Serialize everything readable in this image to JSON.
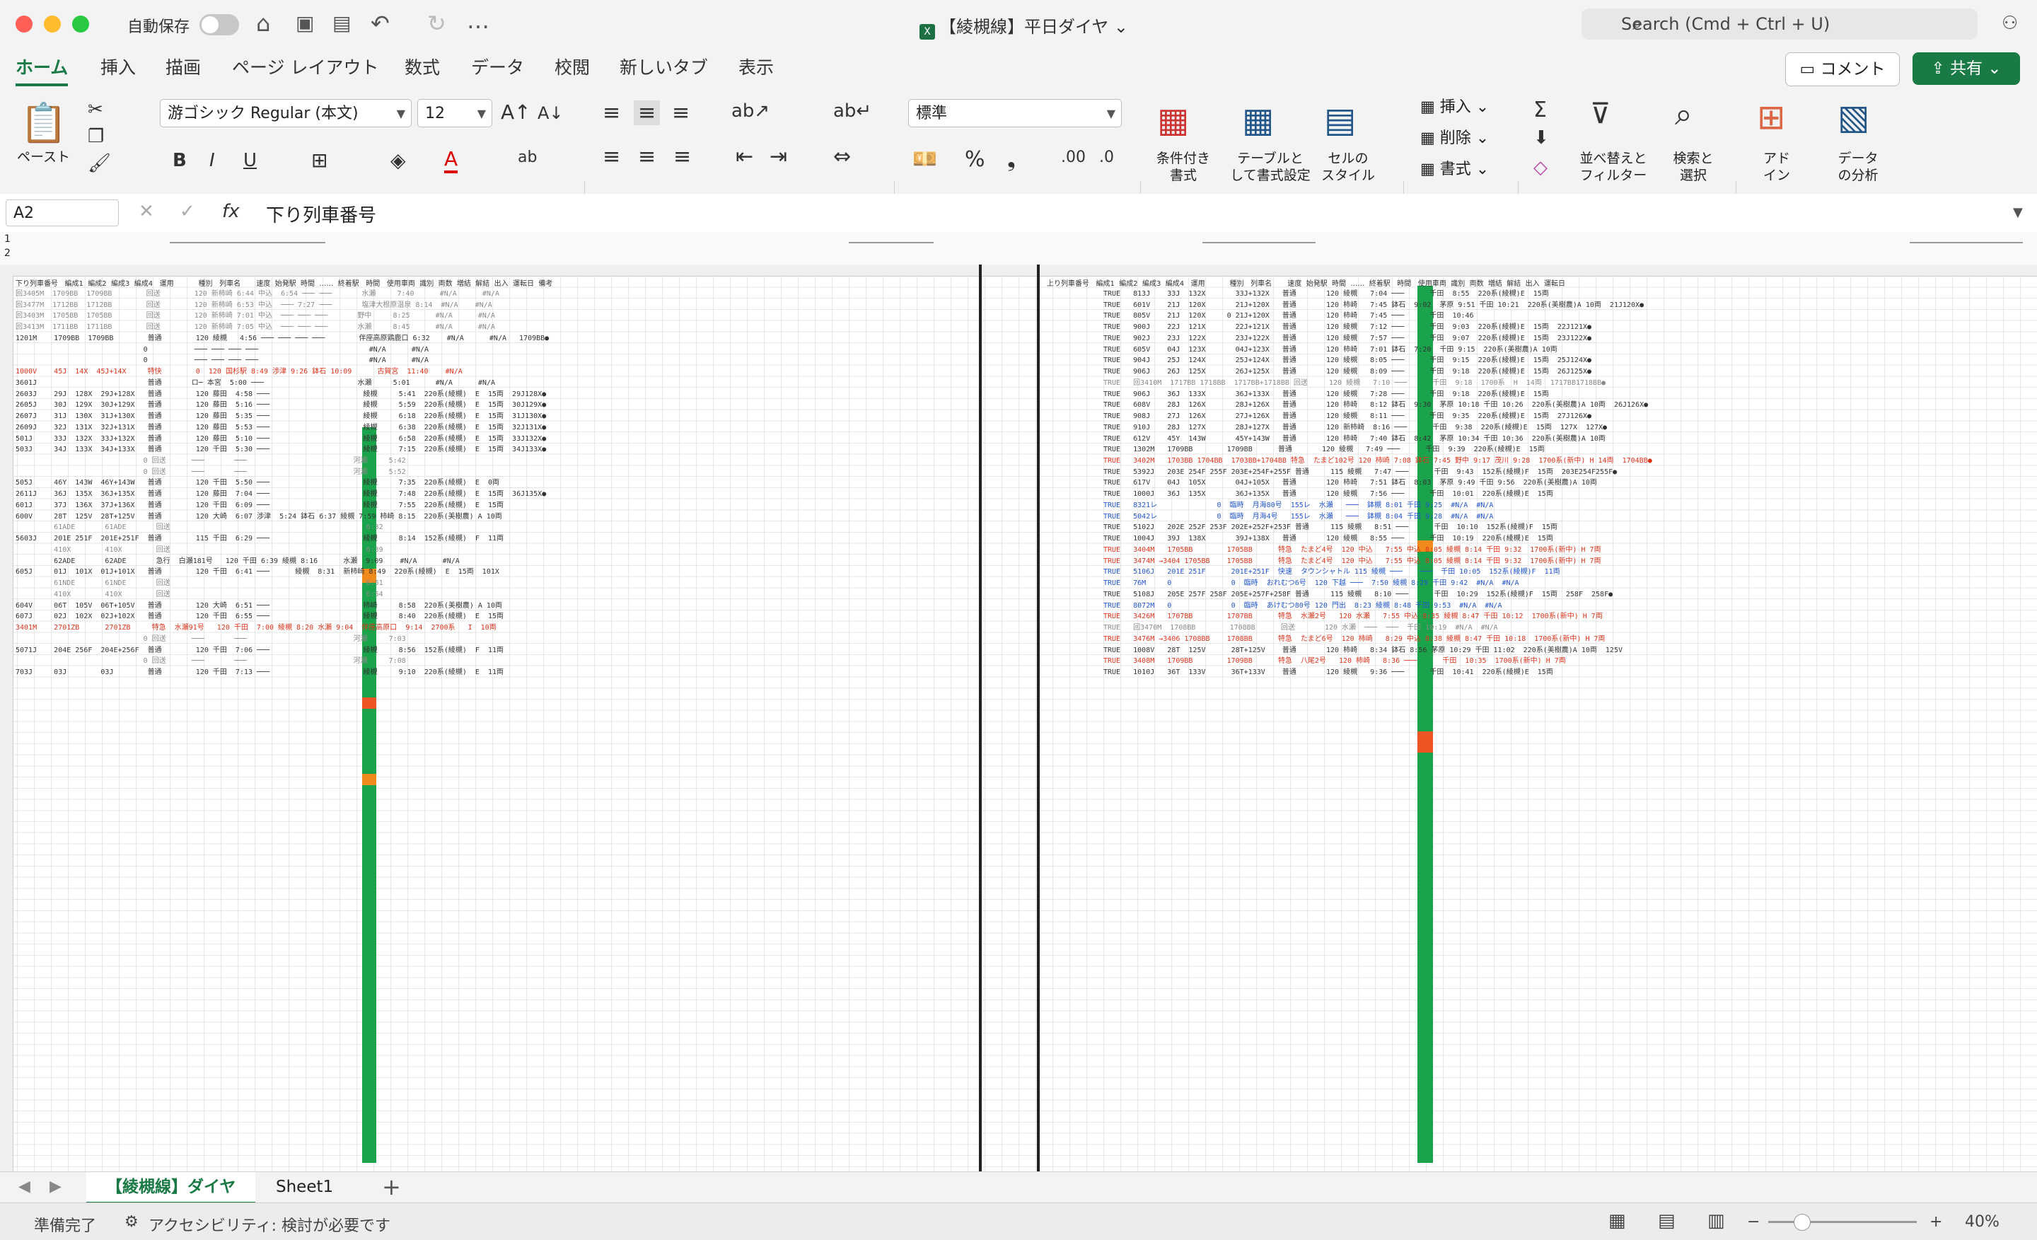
{
  "titlebar": {
    "autosave_label": "自動保存",
    "document_title": "【綾槻線】平日ダイヤ",
    "search_placeholder": "Search (Cmd + Ctrl + U)"
  },
  "tabs": [
    "ホーム",
    "挿入",
    "描画",
    "ページ レイアウト",
    "数式",
    "データ",
    "校閲",
    "新しいタブ",
    "表示"
  ],
  "buttons": {
    "comment": "コメント",
    "share": "共有"
  },
  "ribbon": {
    "paste": "ペースト",
    "font_name": "游ゴシック Regular (本文)",
    "font_size": "12",
    "number_format": "標準",
    "conditional": "条件付き\n書式",
    "table": "テーブルと\nして書式設定",
    "cell_style": "セルの\nスタイル",
    "insert": "挿入",
    "delete": "削除",
    "format": "書式",
    "sort_filter": "並べ替えと\nフィルター",
    "find_select": "検索と\n選択",
    "addin": "アド\nイン",
    "analyze": "データ\nの分析"
  },
  "formula_bar": {
    "name_box": "A2",
    "formula": "下り列車番号"
  },
  "sheet": {
    "left_header": "下り列車番号   編成1  編成2  編成3  編成4   運用           種別   列車名       速度  始発駅  時間  ……  終着駅   時間   使用車両  識別  両数  増結  解結  出入  運転日  備考",
    "right_header": "上り列車番号   編成1  編成2  編成3  編成4   運用           種別   列車名       速度  始発駅  時間  ……  終着駅   時間   使用車両  識別  両数  増結  解結  出入  運転日",
    "left_rows": [
      "回3405M  1709BB  1709BB        回送        120 新柿崎 6:44 中込  6:54 ─── ───       水瀬     7:40      #N/A      #N/A",
      "回3477M  1712BB  1712BB        回送        120 新柿崎 6:53 中込  ─── 7:27 ───       塩津大根原温泉 8:14  #N/A    #N/A",
      "回3403M  1705BB  1705BB        回送        120 新柿崎 7:01 中込  ─── ─── ───       野中     8:25      #N/A      #N/A",
      "回3413M  1711BB  1711BB        回送        120 新柿崎 7:05 中込  ─── ─── ───       水瀬     8:45      #N/A      #N/A",
      "1201M    1709BB  1709BB        普通        120 綾槻   4:56 ─── ─── ─── ───        伴座高原鶏鹿口 6:32    #N/A      #N/A   1709BB●",
      "                              0           ─── ─── ─── ───                          #N/A      #N/A",
      "                              0           ─── ─── ─── ───                          #N/A      #N/A",
      "1000V    45J  14X  45J+14X     特快        0  120 国杉駅 8:49 渉津 9:26 鉢石 10:09      古賀宮  11:40    #N/A",
      "3601J                          普通       ロ─ 本宮  5:00 ───                      水瀬     5:01      #N/A      #N/A",
      "2603J    29J  128X  29J+128X   普通        120 藤田  4:58 ───                      綾槻     5:41  220系(綾槻)  E  15両  29J128X●",
      "2605J    30J  129X  30J+129X   普通        120 藤田  5:16 ───                      綾槻     5:59  220系(綾槻)  E  15両  30J129X●",
      "2607J    31J  130X  31J+130X   普通        120 藤田  5:35 ───                      綾槻     6:18  220系(綾槻)  E  15両  31J130X●",
      "2609J    32J  131X  32J+131X   普通        120 藤田  5:53 ───                      綾槻     6:38  220系(綾槻)  E  15両  32J131X●",
      "501J     33J  132X  33J+132X   普通        120 藤田  5:10 ───                      綾槻     6:58  220系(綾槻)  E  15両  33J132X●",
      "503J     34J  133X  34J+133X   普通        120 千田  5:30 ───                      綾槻     7:15  220系(綾槻)  E  15両  34J133X●",
      "                              0 回送      ───       ───                         河瀬     5:42",
      "                              0 回送      ───       ───                         河瀬     5:52",
      "505J     46Y  143W  46Y+143W   普通        120 千田  5:50 ───                      綾槻     7:35  220系(綾槻)  E  0両",
      "2611J    36J  135X  36J+135X   普通        120 藤田  7:04 ───                      綾槻     7:48  220系(綾槻)  E  15両  36J135X●",
      "601J     37J  136X  37J+136X   普通        120 千田  6:09 ───                      綾槻     7:55  220系(綾槻)  E  15両",
      "600V     28T  125V  28T+125V   普通        120 大崎  6:07 渉津  5:24 鉢石 6:37 綾槻 7:59 柿崎 8:15  220系(美樹農) A 10両",
      "         61ADE       61ADE       回送                                              6:32",
      "5603J    201E 251F  201E+251F  普通        115 千田  6:29 ───                      綾槻     8:14  152系(綾槻)  F  11両",
      "         410X        410X        回送                                              6:39",
      "         62ADE       62ADE       急行  白瀬181号   120 千田 6:39 綾槻 8:16      水瀬  9:09    #N/A      #N/A",
      "605J     01J  101X  01J+101X   普通        120 千田  6:41 ───      綾槻  8:31  新柿崎 8:49  220系(綾槻)  E  15両  101X",
      "         61NDE       61NDE       回送                                              6:51",
      "         410X        410X        回送                                              6:54",
      "604V     06T  105V  06T+105V   普通        120 大崎  6:51 ───                      柿崎     8:58  220系(美樹農) A 10両",
      "607J     02J  102X  02J+102X   普通        120 千田  6:55 ───                      綾槻     8:40  220系(綾槻)  E  15両",
      "3401M    2701ZB      2701ZB     特急  水瀬91号   120 千田  7:00 綾槻 8:20 水瀬 9:04  伴座高原口  9:14  2700系   I  10両",
      "                              0 回送      ───       ───                         河瀬     7:03",
      "5071J    204E 256F  204E+256F  普通        120 千田  7:06 ───                      綾槻     8:56  152系(綾槻)  F  11両",
      "                              0 回送      ───       ───                         河瀬     7:08",
      "703J     03J        03J        普通        120 千田  7:13 ───                      綾槻     9:10  220系(綾槻)  E  11両"
    ],
    "right_rows": [
      "TRUE   813J    33J  132X       33J+132X   普通       120 綾槻   7:04 ───      千田  8:55  220系(綾槻)E  15両",
      "TRUE   601V    21J  120X       21J+120X   普通       120 柿崎   7:45 鉢石  9:02  茅原 9:51 千田 10:21  220系(美樹農)A 10両  21J120X●",
      "TRUE   805V    21J  120X     0 21J+120X   普通       120 柿崎   7:45 ───      千田  10:46",
      "TRUE   900J    22J  121X       22J+121X   普通       120 綾槻   7:12 ───      千田  9:03  220系(綾槻)E  15両  22J121X●",
      "TRUE   902J    23J  122X       23J+122X   普通       120 綾槻   7:57 ───      千田  9:07  220系(綾槻)E  15両  23J122X●",
      "TRUE   605V    04J  123X       04J+123X   普通       120 柿崎   7:01 鉢石  7:20  千田 9:15  220系(美樹農)A 10両",
      "TRUE   904J    25J  124X       25J+124X   普通       120 綾槻   8:05 ───      千田  9:15  220系(綾槻)E  15両  25J124X●",
      "TRUE   906J    26J  125X       26J+125X   普通       120 綾槻   8:09 ───      千田  9:18  220系(綾槻)E  15両  26J125X●",
      "TRUE   回3410M  1717BB 1718BB  1717BB+1718BB 回送     120 綾槻   7:10 ───      千田  9:18  1700系  H  14両  1717BB1718BB●",
      "TRUE   906J    36J  133X       36J+133X   普通       120 綾槻   7:28 ───      千田  9:18  220系(綾槻)E  15両",
      "TRUE   608V    28J  126X       28J+126X   普通       120 柿崎   8:12 鉢石  9:30  茅原 10:18 千田 10:26  220系(美樹農)A 10両  26J126X●",
      "TRUE   908J    27J  126X       27J+126X   普通       120 綾槻   8:11 ───      千田  9:35  220系(綾槻)E  15両  27J126X●",
      "TRUE   910J    28J  127X       28J+127X   普通       120 新柿崎  8:16 ───      千田  9:38  220系(綾槻)E  15両  127X  127X●",
      "TRUE   612V    45Y  143W       45Y+143W   普通       120 柿崎   7:40 鉢石  8:42  茅原 10:34 千田 10:36  220系(美樹農)A 10両",
      "TRUE   1302M   1709BB        1709BB      普通       120 綾槻   7:49 ───      千田  9:39  220系(綾槻)E  15両",
      "TRUE   3402M   1703BB 1704BB  1703BB+1704BB 特急  たまど102号 120 柿崎 7:08 鉢石 7:45 野中 9:17 茂川 9:28  1700系(新中) H 14両  1704BB●",
      "TRUE   5392J   203E 254F 255F 203E+254F+255F 普通     115 綾槻   7:47 ───      千田  9:43  152系(綾槻)F  15両  203E254F255F●",
      "TRUE   617V    04J  105X       04J+105X   普通       120 柿崎   7:51 鉢石  8:03  茅原 9:49 千田 9:56  220系(美樹農)A 10両",
      "TRUE   1000J   36J  135X       36J+135X   普通       120 綾槻   7:56 ───      千田  10:01  220系(綾槻)E  15両",
      "TRUE   8321レ              0  臨時  月海80号  155レ  水瀬   ───  鉢槻 8:01 千田 9:25  #N/A  #N/A",
      "TRUE   5042レ              0  臨時  月海4号   155レ  水瀬   ───  鉢槻 8:04 千田 9:28  #N/A  #N/A",
      "TRUE   5102J   202E 252F 253F 202E+252F+253F 普通     115 綾槻   8:51 ───      千田  10:10  152系(綾槻)F  15両",
      "TRUE   1004J   39J  138X       39J+138X   普通       120 綾槻   8:55 ───      千田  10:19  220系(綾槻)E  15両",
      "TRUE   3404M   1705BB        1705BB      特急  たまど4号  120 中込   7:55 中込 8:05 綾槻 8:14 千田 9:32  1700系(新中) H 7両",
      "TRUE   3474M →3404 1705BB    1705BB      特急  たまど4号  120 中込   7:55 中込 8:05 綾槻 8:14 千田 9:32  1700系(新中) H 7両",
      "TRUE   5106J   201E 251F      201E+251F  快速  タウンシャトル 115 綾槻 ───    ───  千田 10:05  152系(綾槻)F  11両",
      "TRUE   76M     0              0  臨時  おれむつ6号  120 下越 ───  7:50 綾槻 8:29 千田 9:42  #N/A  #N/A",
      "TRUE   5108J   205E 257F 258F 205E+257F+258F 普通     115 綾槻   8:10 ───      千田  10:29  152系(綾槻)F  15両  258F  258F●",
      "TRUE   8072M   0              0  臨時  あけむつ80号 120 門出  8:23 綾槻 8:48 千田 9:53  #N/A  #N/A",
      "TRUE   3426M   1707BB        1707BB      特急  水瀬2号   120 水瀬   7:55 中込 8:35 綾槻 8:47 千田 10:12  1700系(新中) H 7両",
      "TRUE   回3470M  1708BB        1708BB      回送       120 水瀬  ───  ───  千田 10:19  #N/A  #N/A",
      "TRUE   3476M →3406 1708BB    1708BB      特急  たまど6号  120 柿崎   8:29 中込 8:38 綾槻 8:47 千田 10:18  1700系(新中) H 7両",
      "TRUE   1008V   28T  125V      28T+125V    普通       120 柿崎   8:34 鉢石 8:56 茅原 10:29 千田 11:02  220系(美樹農)A 10両  125V",
      "TRUE   3408M   1709BB        1709BB      特急  八尾2号   120 柿崎   8:36 ───      千田  10:35  1700系(新中) H 7両",
      "TRUE   1010J   36T  133V      36T+133V    普通       120 綾槻   9:36 ───      千田  10:41  220系(綾槻)E  15両"
    ]
  },
  "sheet_tabs": [
    "【綾槻線】ダイヤ",
    "Sheet1"
  ],
  "status": {
    "ready": "準備完了",
    "accessibility": "アクセシビリティ: 検討が必要です",
    "zoom": "40%"
  }
}
